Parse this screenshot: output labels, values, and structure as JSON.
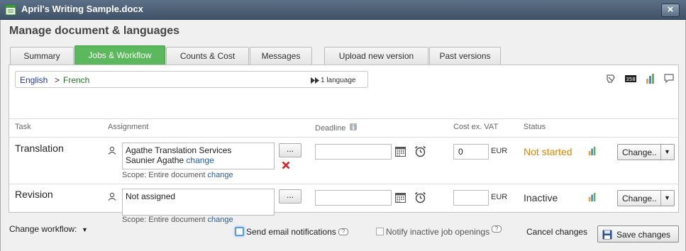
{
  "window": {
    "title": "April's Writing Sample.docx",
    "close_label": "×"
  },
  "heading": "Manage document & languages",
  "tabs": [
    "Summary",
    "Jobs & Workflow",
    "Counts & Cost",
    "Messages",
    "Upload new version",
    "Past versions"
  ],
  "active_tab": "Jobs & Workflow",
  "languages": {
    "source": "English",
    "separator": ">",
    "target": "French",
    "count": "1 language"
  },
  "toolbar_icons": [
    "translate-icon",
    "word-count-icon",
    "stats-icon",
    "comment-icon"
  ],
  "columns": {
    "task": "Task",
    "assignment": "Assignment",
    "deadline": "Deadline",
    "cost": "Cost ex. VAT",
    "status": "Status"
  },
  "jobs": [
    {
      "task": "Translation",
      "assignee_line1": "Agathe Translation Services",
      "assignee_line2": "Saunier Agathe",
      "assignee_change": "change",
      "scope_label": "Scope: Entire document",
      "scope_change": "change",
      "browse_label": "...",
      "deadline": "",
      "cost": "0",
      "currency": "EUR",
      "status": "Not started",
      "status_color": "#d4880f",
      "action_label": "Change.."
    },
    {
      "task": "Revision",
      "assignee_line1": "Not assigned",
      "scope_label": "Scope: Entire document",
      "scope_change": "change",
      "browse_label": "...",
      "deadline": "",
      "cost": "",
      "currency": "EUR",
      "status": "Inactive",
      "status_color": "#333333",
      "action_label": "Change.."
    }
  ],
  "footer": {
    "change_workflow": "Change workflow:",
    "send_email": "Send email notifications",
    "send_email_checked": false,
    "notify_inactive": "Notify inactive job openings",
    "notify_inactive_checked": false,
    "cancel": "Cancel changes",
    "save": "Save changes"
  },
  "colors": {
    "accent_green": "#5cb85c",
    "titlebar": "#4a5d73",
    "link": "#1d5fa8"
  }
}
